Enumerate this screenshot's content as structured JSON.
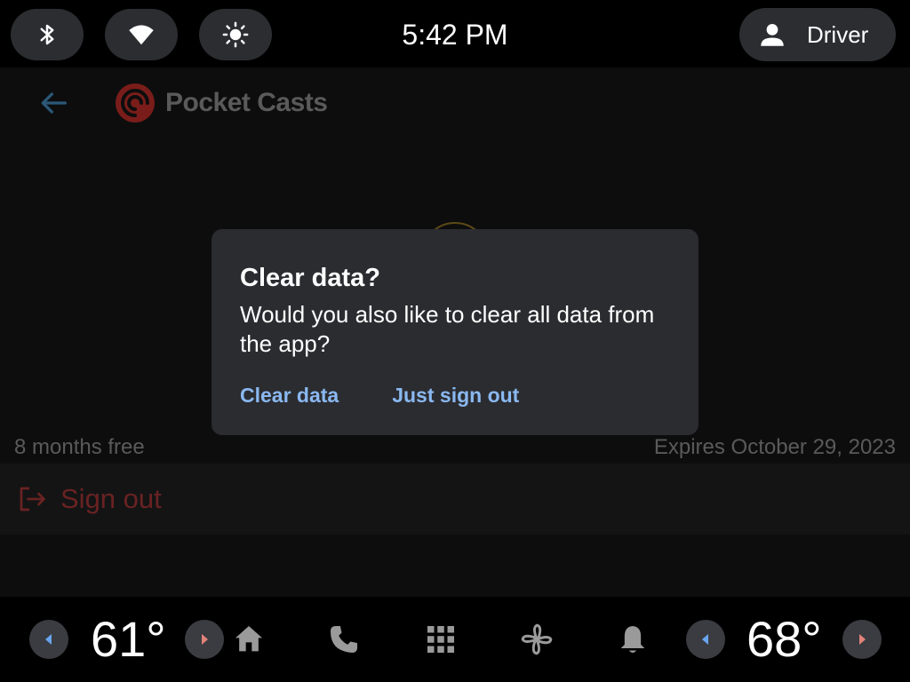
{
  "status_bar": {
    "time": "5:42 PM",
    "profile_name": "Driver",
    "icons": [
      "bluetooth-icon",
      "wifi-icon",
      "brightness-icon",
      "person-icon"
    ]
  },
  "app": {
    "brand_name": "Pocket Casts",
    "plan_label": "8 months free",
    "expiry_label": "Expires October 29, 2023",
    "signout_label": "Sign out"
  },
  "dialog": {
    "title": "Clear data?",
    "body": "Would you also like to clear all data from the app?",
    "primary_action": "Clear data",
    "secondary_action": "Just sign out"
  },
  "bottom_bar": {
    "left_temp": "61°",
    "right_temp": "68°",
    "nav_icons": [
      "home-icon",
      "phone-icon",
      "apps-grid-icon",
      "fan-icon",
      "bell-icon"
    ]
  },
  "colors": {
    "accent_link": "#8ab8f0",
    "left_arrow_blue": "#6aa6f0",
    "right_arrow_red": "#e2837a",
    "brand_red": "#c0392b",
    "signout_red": "#6a2222"
  }
}
